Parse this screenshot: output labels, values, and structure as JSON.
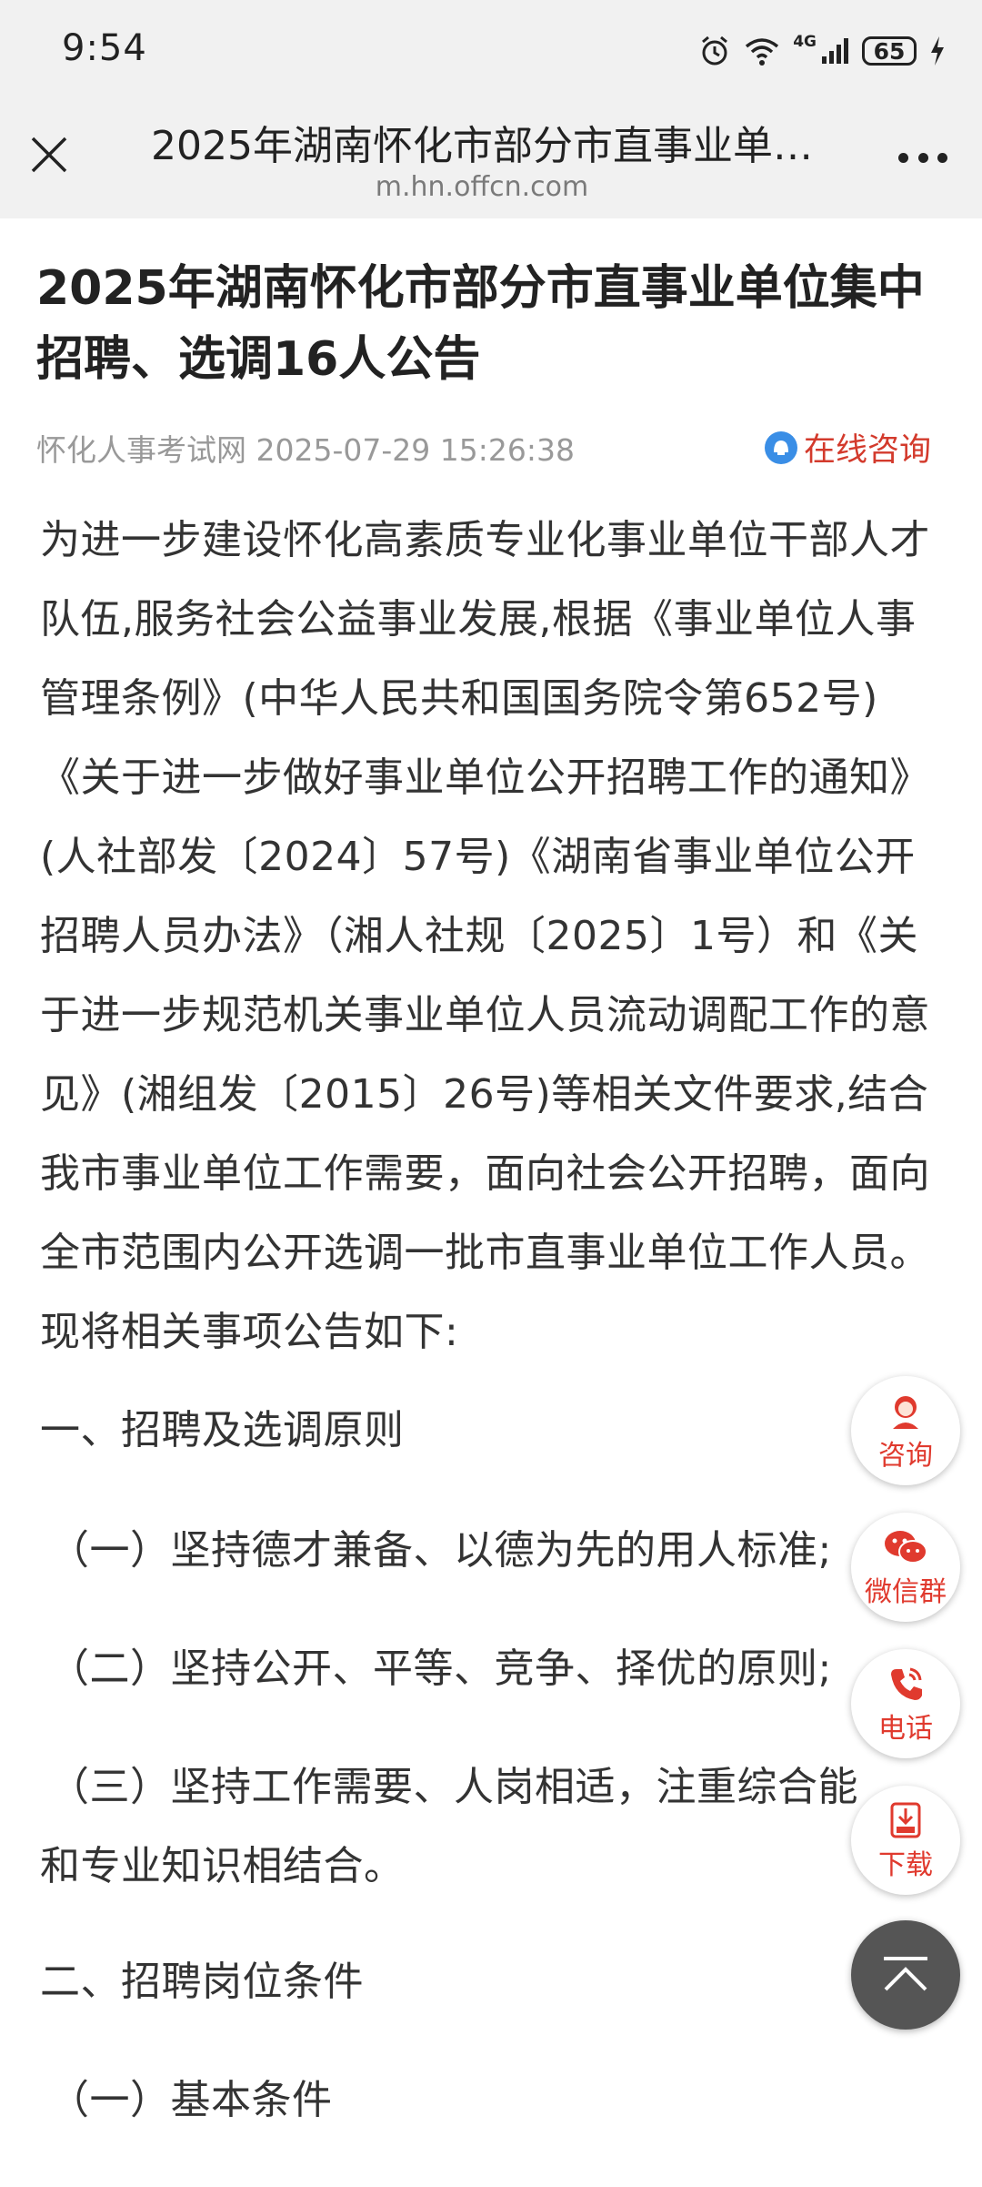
{
  "status_bar": {
    "time": "9:54",
    "network_label": "4G",
    "battery": "65"
  },
  "nav": {
    "title": "2025年湖南怀化市部分市直事业单…",
    "url": "m.hn.offcn.com"
  },
  "article": {
    "title": "2025年湖南怀化市部分市直事业单位集中招聘、选调16人公告",
    "source": "怀化人事考试网",
    "datetime": "2025-07-29 15:26:38",
    "consult_link": "在线咨询",
    "paragraphs": {
      "intro": "为进一步建设怀化高素质专业化事业单位干部人才队伍,服务社会公益事业发展,根据《事业单位人事管理条例》(中华人民共和国国务院令第652号)《关于进一步做好事业单位公开招聘工作的通知》(人社部发〔2024〕57号)《湖南省事业单位公开招聘人员办法》（湘人社规〔2025〕1号）和《关于进一步规范机关事业单位人员流动调配工作的意见》(湘组发〔2015〕26号)等相关文件要求,结合我市事业单位工作需要，面向社会公开招聘，面向全市范围内公开选调一批市直事业单位工作人员。现将相关事项公告如下:",
      "heading1": "一、招聘及选调原则",
      "sub1": "（一）坚持德才兼备、以德为先的用人标准;",
      "sub2": "（二）坚持公开、平等、竞争、择优的原则;",
      "sub3a": "（三）坚持工作需要、人岗相适，注重综合能",
      "sub3b": "和专业知识相结合。",
      "heading2": "二、招聘岗位条件",
      "sub4": "（一）基本条件"
    }
  },
  "floating": {
    "consult": "咨询",
    "wechat": "微信群",
    "phone": "电话",
    "download": "下载"
  },
  "colors": {
    "accent": "#e03a2e",
    "bar": "#f1f1f1"
  }
}
